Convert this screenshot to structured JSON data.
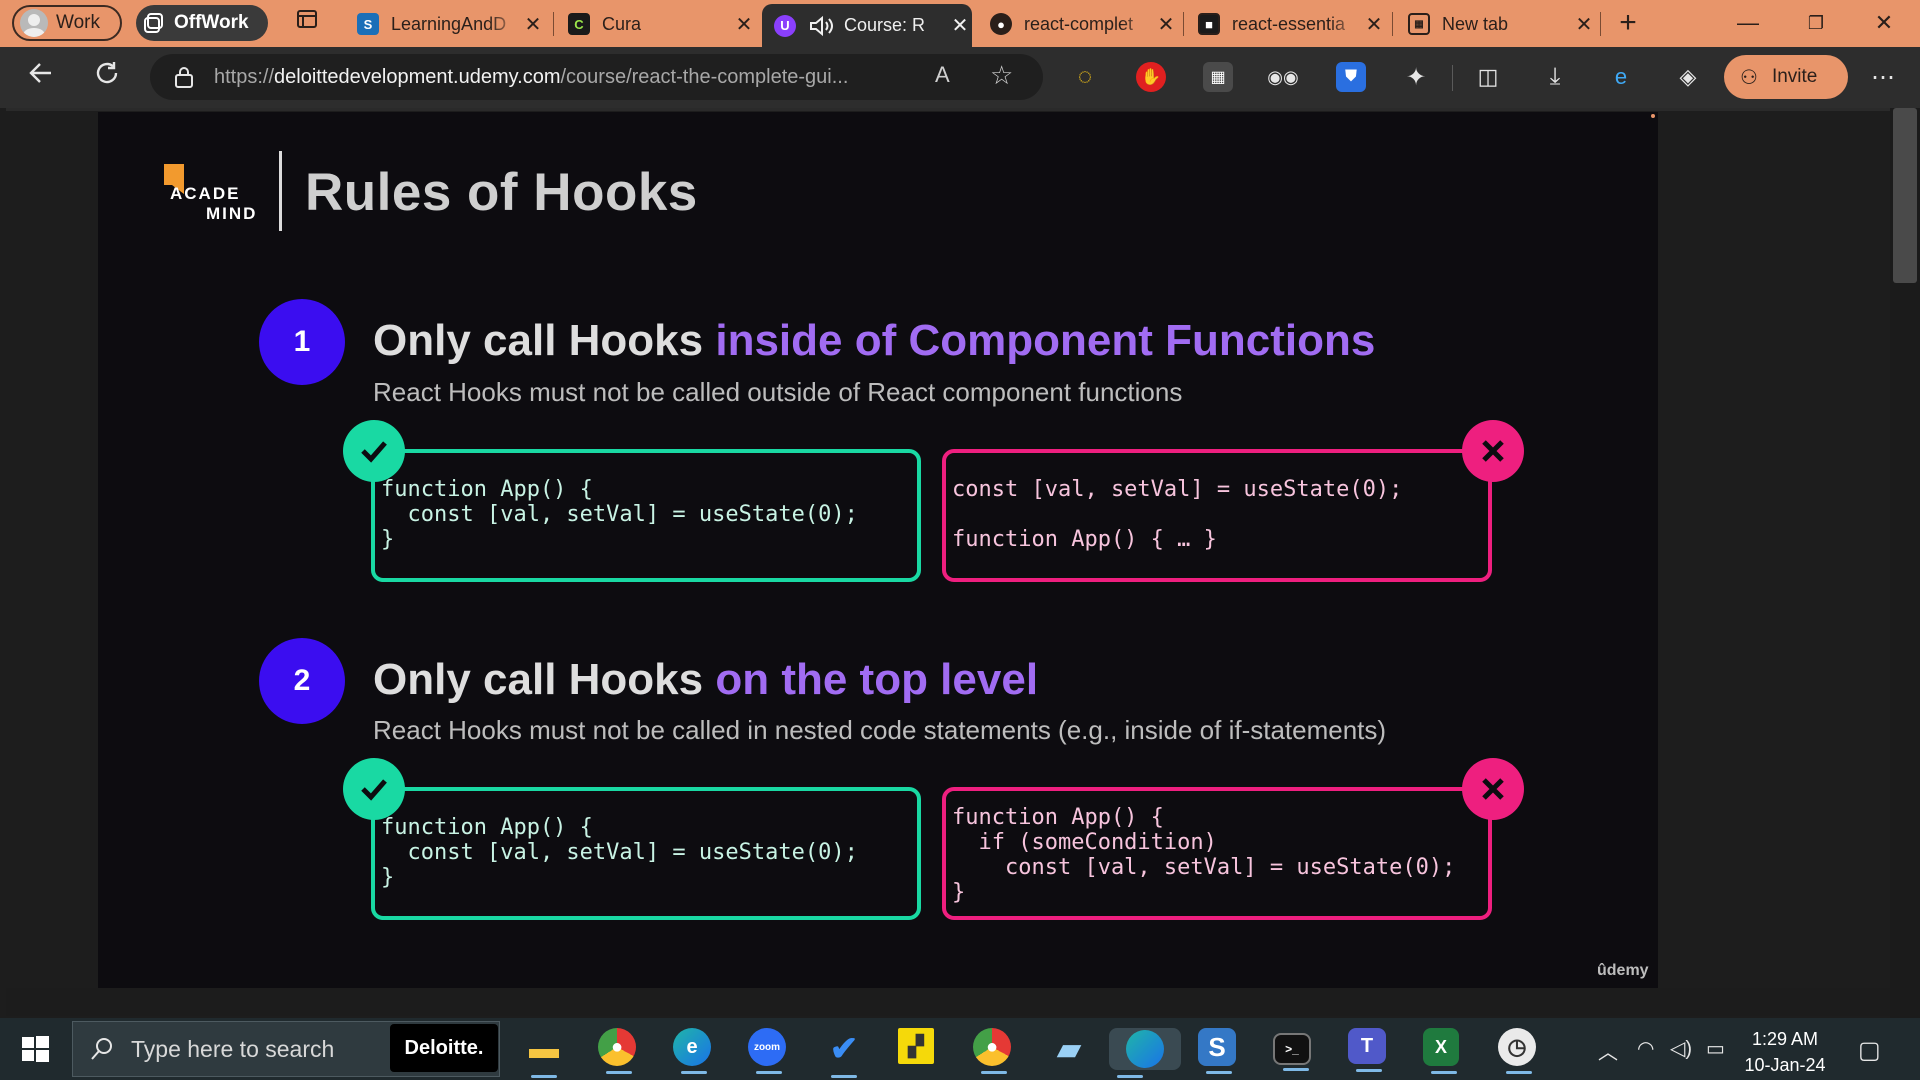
{
  "browser": {
    "profiles": [
      {
        "label": "Work"
      },
      {
        "label": "OffWork"
      }
    ],
    "tabs": [
      {
        "title": "LearningAndD",
        "icon": "sharepoint-icon"
      },
      {
        "title": "Cura",
        "icon": "cura-icon"
      },
      {
        "title": "Course: R",
        "icon": "udemy-icon",
        "active": true
      },
      {
        "title": "react-complet",
        "icon": "github-icon"
      },
      {
        "title": "react-essentia",
        "icon": "page-icon"
      },
      {
        "title": "New tab",
        "icon": "newtab-icon"
      }
    ],
    "address": {
      "prefix": "https://",
      "host": "deloittedevelopment.udemy.com",
      "path": "/course/react-the-complete-gui..."
    },
    "invite_label": "Invite"
  },
  "slide": {
    "logo_top": "ACADE",
    "logo_bottom": "MIND",
    "title": "Rules of Hooks",
    "rules": [
      {
        "number": "1",
        "head_plain": "Only call Hooks ",
        "head_highlight": "inside of Component Functions",
        "sub": "React Hooks must not be called outside of React component functions",
        "good_code": "function App() {\n  const [val, setVal] = useState(0);\n}",
        "bad_code": "const [val, setVal] = useState(0);\n\nfunction App() { … }"
      },
      {
        "number": "2",
        "head_plain": "Only call Hooks ",
        "head_highlight": "on the top level",
        "sub": "React Hooks must not be called in nested code statements (e.g., inside of if-statements)",
        "good_code": "function App() {\n  const [val, setVal] = useState(0);\n}",
        "bad_code": "function App() {\n  if (someCondition)\n    const [val, setVal] = useState(0);\n}"
      }
    ],
    "watermark": "ûdemy"
  },
  "taskbar": {
    "search_placeholder": "Type here to search",
    "deloitte_label": "Deloitte.",
    "time": "1:29 AM",
    "date": "10-Jan-24",
    "apps": [
      "file-explorer-icon",
      "chrome-icon",
      "edge-icon",
      "zoom-icon",
      "todo-icon",
      "sticky-notes-icon",
      "chrome-icon",
      "notepad-icon",
      "edge-icon",
      "s-app-icon",
      "terminal-icon",
      "teams-icon",
      "excel-icon",
      "clock-icon"
    ],
    "colors": {
      "accent": "#e8956a",
      "good": "#19d9a3",
      "bad": "#ee1f7f",
      "highlight": "#a16cf2",
      "number": "#3b0df0"
    }
  }
}
